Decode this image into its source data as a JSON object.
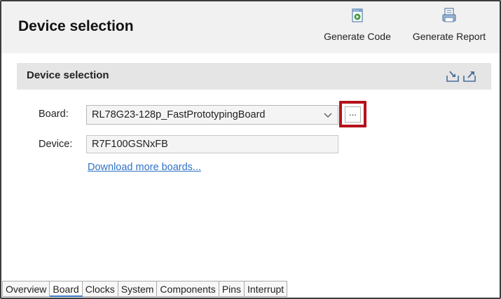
{
  "header": {
    "title": "Device selection",
    "toolbar": [
      {
        "label": "Generate Code",
        "icon": "generate-code-icon"
      },
      {
        "label": "Generate Report",
        "icon": "generate-report-icon"
      }
    ]
  },
  "section": {
    "title": "Device selection",
    "icons": [
      "import-icon",
      "export-icon"
    ]
  },
  "form": {
    "board_label": "Board:",
    "board_value": "RL78G23-128p_FastPrototypingBoard",
    "browse_label": "...",
    "device_label": "Device:",
    "device_value": "R7F100GSNxFB",
    "download_link": "Download more boards..."
  },
  "tabs": [
    {
      "label": "Overview",
      "active": false
    },
    {
      "label": "Board",
      "active": true
    },
    {
      "label": "Clocks",
      "active": false
    },
    {
      "label": "System",
      "active": false
    },
    {
      "label": "Components",
      "active": false
    },
    {
      "label": "Pins",
      "active": false
    },
    {
      "label": "Interrupt",
      "active": false
    }
  ],
  "colors": {
    "highlight": "#b5121b",
    "link": "#2f72c4",
    "section_bg": "#e5e5e5",
    "header_bg": "#f1f1f1"
  }
}
